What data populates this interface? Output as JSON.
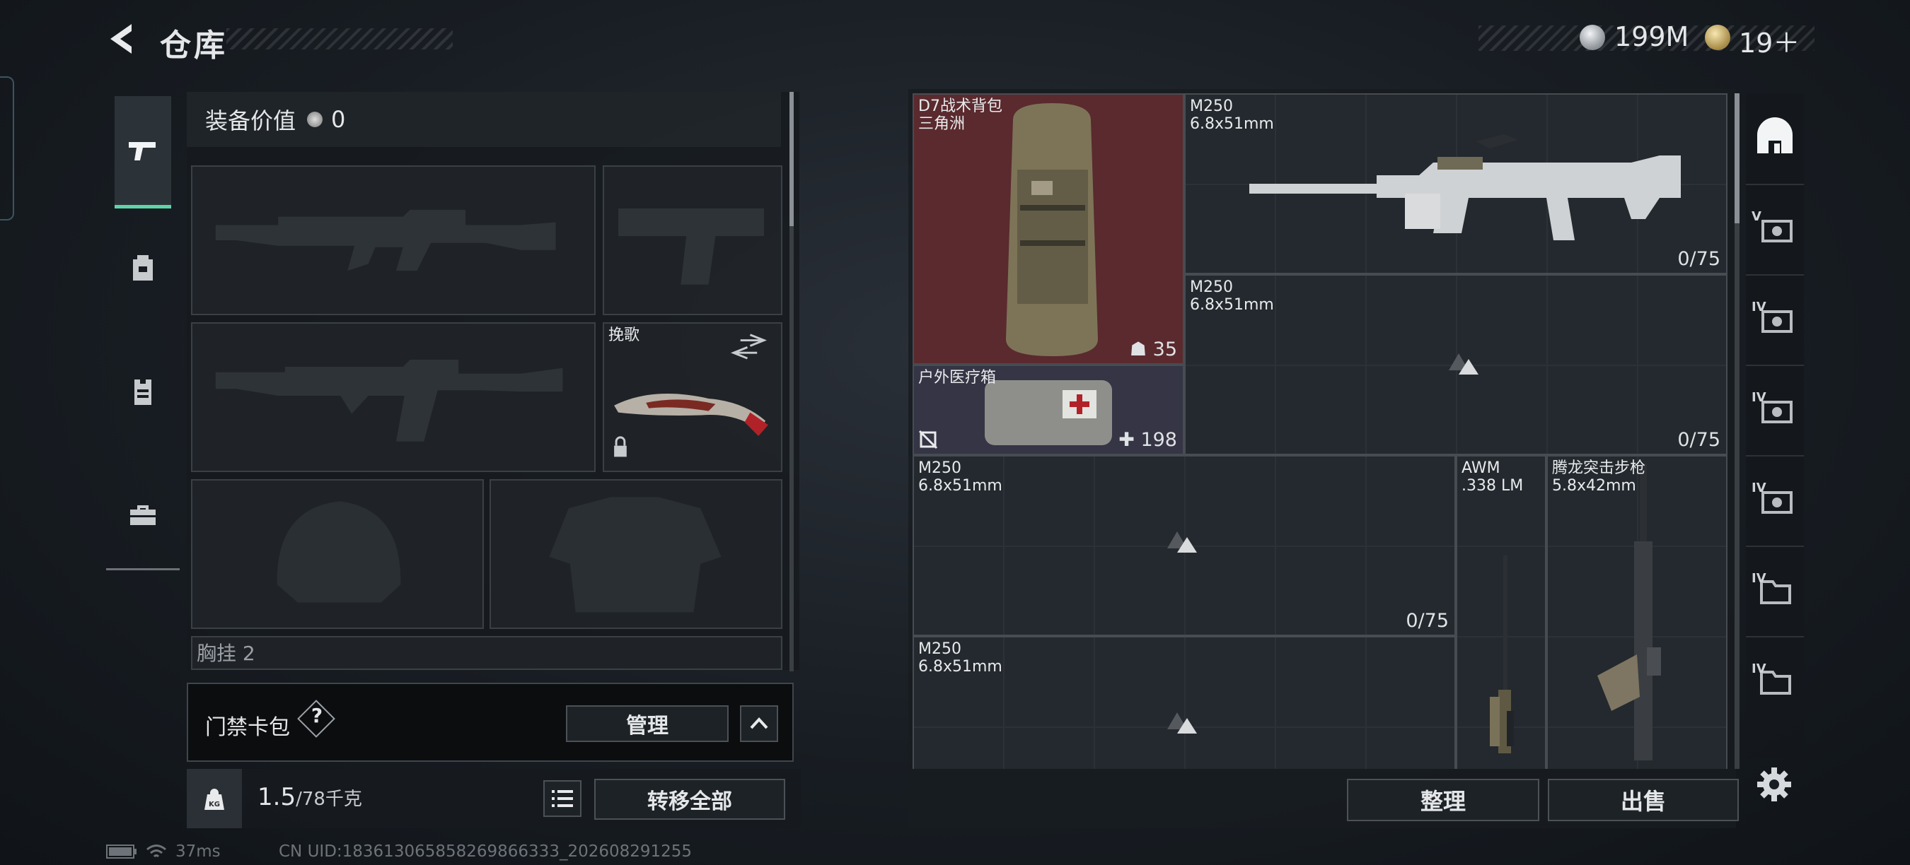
{
  "header": {
    "title": "仓库",
    "currency": [
      {
        "icon": "silver-coin-icon",
        "value": "199M"
      },
      {
        "icon": "gold-coin-icon",
        "value": "19＋"
      }
    ]
  },
  "left_tabs": [
    "pistol-icon",
    "backpack-icon",
    "vest-icon",
    "toolbox-icon"
  ],
  "equipment": {
    "value_label": "装备价值",
    "value": "0",
    "melee_slot": {
      "name": "挽歌"
    },
    "next_section_label": "胸挂 2"
  },
  "access_cards": {
    "label": "门禁卡包",
    "help": "?",
    "manage_label": "管理"
  },
  "weight": {
    "current": "1.5",
    "capacity": "/78千克",
    "kg_badge": "KG",
    "transfer_all_label": "转移全部"
  },
  "stash_items": [
    {
      "name": "D7战术背包\n三角洲",
      "count": "35"
    },
    {
      "name": "M250\n6.8x51mm",
      "capacity": "0/75"
    },
    {
      "name": "M250\n6.8x51mm",
      "capacity": "0/75"
    },
    {
      "name": "户外医疗箱",
      "count": "198"
    },
    {
      "name": "M250\n6.8x51mm",
      "capacity": "0/75"
    },
    {
      "name": "AWM\n.338 LM"
    },
    {
      "name": "腾龙突击步枪\n5.8x42mm"
    },
    {
      "name": "M250\n6.8x51mm"
    }
  ],
  "actions": {
    "sort_label": "整理",
    "sell_label": "出售"
  },
  "right_tabs": [
    "V",
    "IV",
    "IV",
    "IV",
    "IV",
    "IV"
  ],
  "status_bar": {
    "ping": "37ms",
    "uid": "CN UID:18361306585826986​6333_202608291255"
  },
  "colors": {
    "accent": "#5fd4a8",
    "backpack_bg": "#5a2a2e",
    "medkit_bg": "#353545"
  }
}
